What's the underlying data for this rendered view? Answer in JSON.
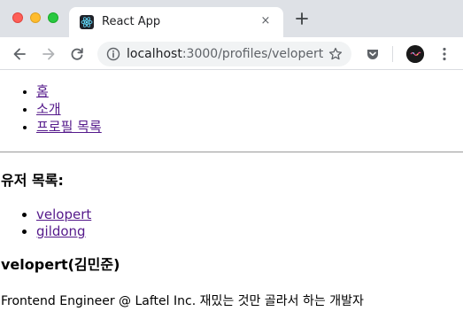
{
  "browser": {
    "tab": {
      "title": "React App",
      "close_glyph": "×",
      "favicon": "react-logo-icon"
    },
    "new_tab_glyph": "+",
    "address": {
      "host": "localhost",
      "path": ":3000/profiles/velopert"
    }
  },
  "nav": {
    "items": [
      {
        "label": "홈"
      },
      {
        "label": "소개"
      },
      {
        "label": "프로필 목록"
      }
    ]
  },
  "users": {
    "heading": "유저 목록:",
    "items": [
      {
        "label": "velopert"
      },
      {
        "label": "gildong"
      }
    ]
  },
  "profile": {
    "name": "velopert(김민준)",
    "bio": "Frontend Engineer @ Laftel Inc. 재밌는 것만 골라서 하는 개발자"
  },
  "colors": {
    "visited_link": "#551a8b",
    "tabstrip": "#dee1e6",
    "omnibox": "#f1f3f4"
  }
}
